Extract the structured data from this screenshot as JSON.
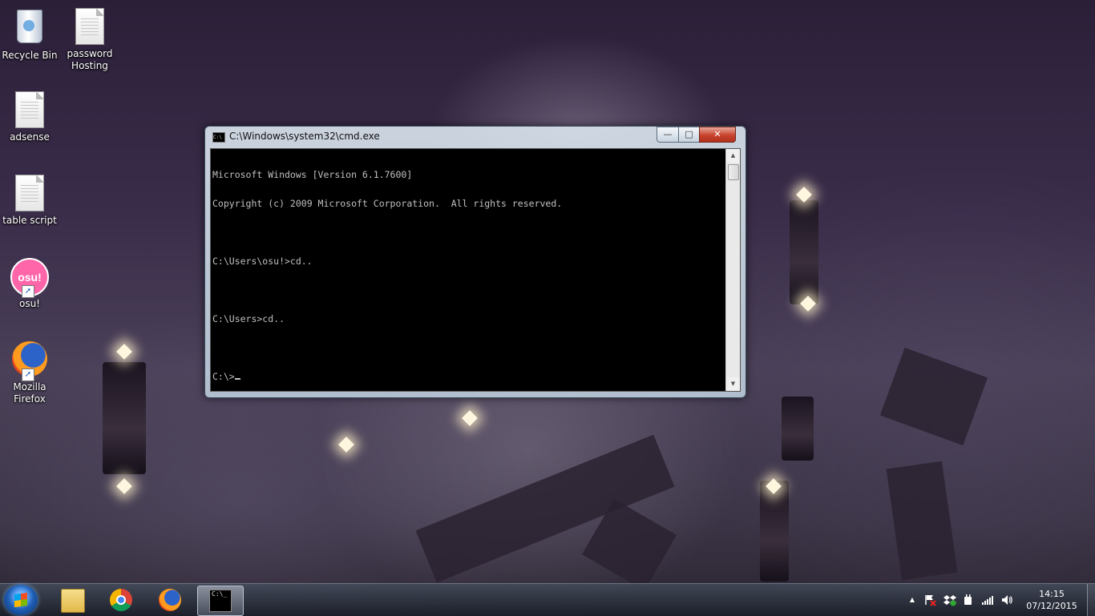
{
  "desktop": {
    "icons": [
      {
        "label_line1": "Recycle Bin",
        "label_line2": "",
        "icon": "recycle-bin-icon"
      },
      {
        "label_line1": "password",
        "label_line2": "Hosting",
        "icon": "text-file-icon"
      },
      {
        "label_line1": "adsense",
        "label_line2": "",
        "icon": "text-file-icon"
      },
      {
        "label_line1": "table script",
        "label_line2": "",
        "icon": "text-file-icon"
      },
      {
        "label_line1": "osu!",
        "label_line2": "",
        "icon": "osu-icon",
        "glyph_text": "osu!"
      },
      {
        "label_line1": "Mozilla",
        "label_line2": "Firefox",
        "icon": "firefox-icon"
      }
    ]
  },
  "cmd": {
    "title": "C:\\Windows\\system32\\cmd.exe",
    "icon_text": "C:\\",
    "lines": [
      "Microsoft Windows [Version 6.1.7600]",
      "Copyright (c) 2009 Microsoft Corporation.  All rights reserved.",
      "",
      "C:\\Users\\osu!>cd..",
      "",
      "C:\\Users>cd..",
      "",
      "C:\\>"
    ],
    "minimize_glyph": "—",
    "maximize_glyph": "□",
    "close_glyph": "✕"
  },
  "taskbar": {
    "pinned": [
      "windows-explorer-icon",
      "chrome-icon",
      "firefox-icon",
      "cmd-icon"
    ],
    "cmd_glyph_text": "C:\\_",
    "tray": {
      "show_hidden_glyph": "▲",
      "clock_time": "14:15",
      "clock_date": "07/12/2015"
    }
  }
}
